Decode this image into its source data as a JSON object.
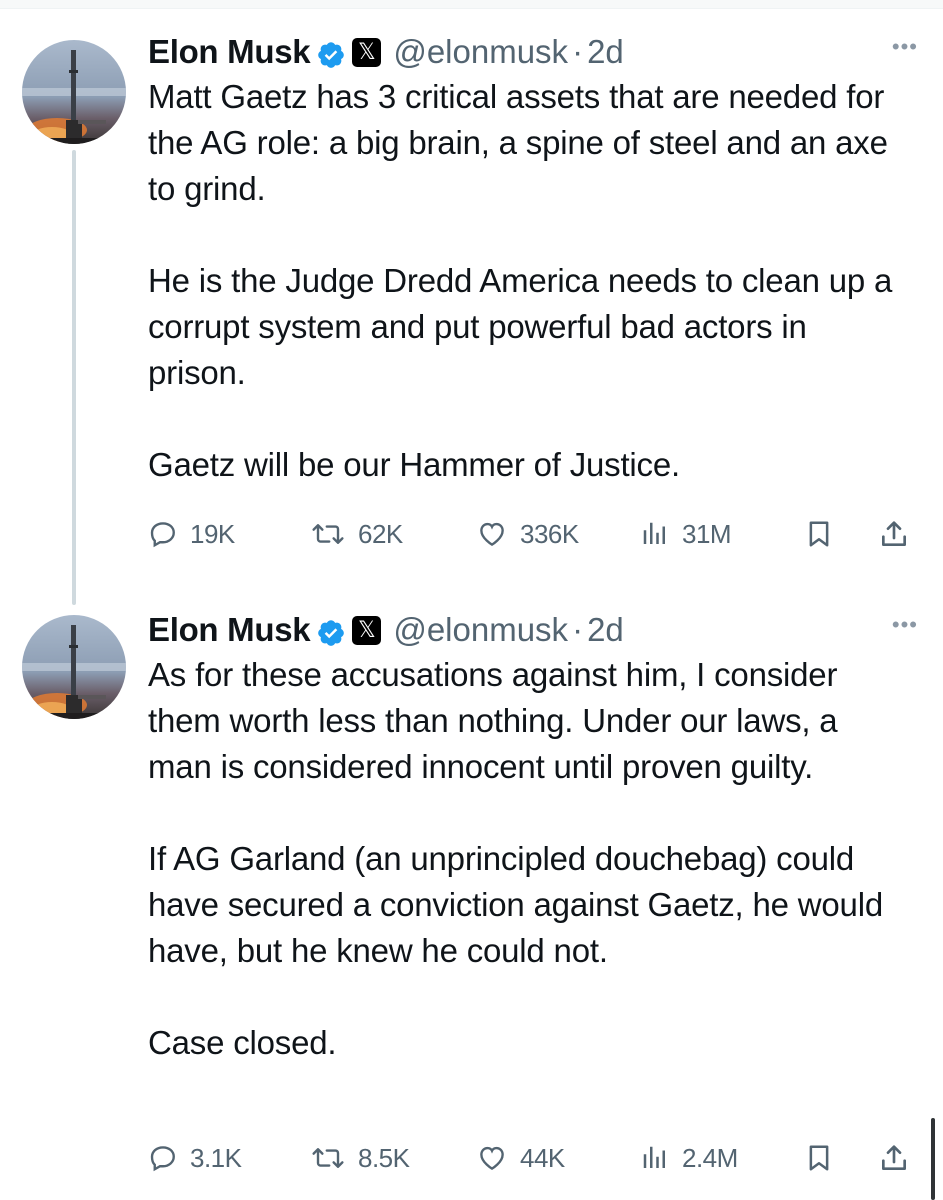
{
  "tweets": [
    {
      "author_name": "Elon Musk",
      "handle": "@elonmusk",
      "separator": "·",
      "time": "2d",
      "more_label": "•••",
      "affiliation_label": "𝕏",
      "text": "Matt Gaetz has 3 critical assets that are needed for the AG role: a big brain, a spine of steel and an axe to grind.\n\nHe is the Judge Dredd America needs to clean up a corrupt system and put powerful bad actors in prison.\n\nGaetz will be our Hammer of Justice.",
      "replies": "19K",
      "reposts": "62K",
      "likes": "336K",
      "views": "31M"
    },
    {
      "author_name": "Elon Musk",
      "handle": "@elonmusk",
      "separator": "·",
      "time": "2d",
      "more_label": "•••",
      "affiliation_label": "𝕏",
      "text": "As for these accusations against him, I consider them worth less than nothing. Under our laws, a man is considered innocent until proven guilty.\n\nIf AG Garland (an unprincipled douchebag) could have secured a conviction against Gaetz, he would have, but he knew he could not.\n\nCase closed.",
      "replies": "3.1K",
      "reposts": "8.5K",
      "likes": "44K",
      "views": "2.4M"
    }
  ],
  "icons": {
    "verified": "verified-badge-icon",
    "affiliation": "x-logo-icon",
    "more": "more-icon",
    "reply": "reply-icon",
    "repost": "repost-icon",
    "like": "heart-icon",
    "views": "views-icon",
    "bookmark": "bookmark-icon",
    "share": "share-icon"
  },
  "colors": {
    "text": "#0f1419",
    "secondary": "#536471",
    "verified": "#1d9bf0",
    "thread_line": "#cfd9de"
  }
}
